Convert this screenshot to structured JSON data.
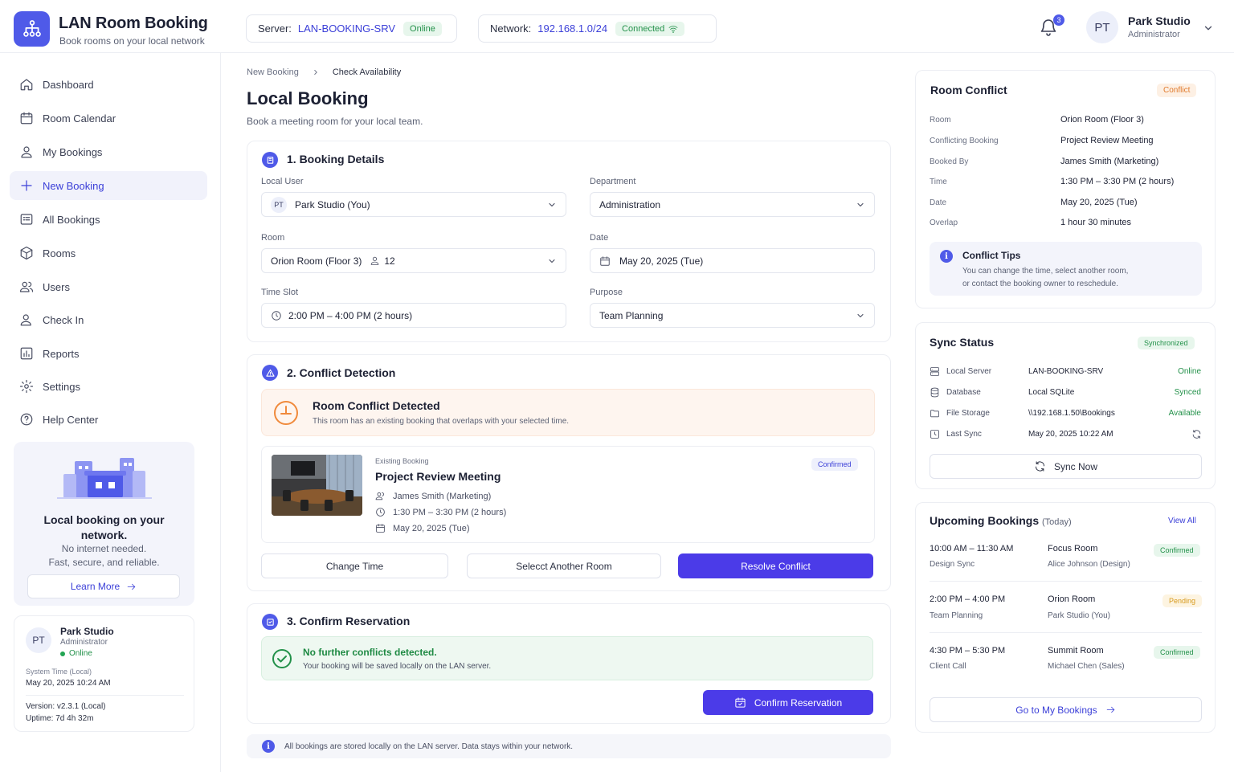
{
  "app": {
    "title": "LAN Room Booking",
    "subtitle": "Book rooms on your local network",
    "server_label": "Server:",
    "server_value": "LAN-BOOKING-SRV",
    "server_status": "Online",
    "network_label": "Network:",
    "network_value": "192.168.1.0/24",
    "network_status": "Connected",
    "notification_count": "3",
    "user_initials": "PT",
    "user_name": "Park Studio",
    "user_role": "Administrator"
  },
  "sidebar": {
    "items": [
      {
        "label": "Dashboard",
        "icon": "home-icon"
      },
      {
        "label": "Room Calendar",
        "icon": "calendar-icon"
      },
      {
        "label": "My Bookings",
        "icon": "user-icon"
      },
      {
        "label": "New Booking",
        "icon": "plus-icon",
        "active": true
      },
      {
        "label": "All Bookings",
        "icon": "list-icon"
      },
      {
        "label": "Rooms",
        "icon": "cube-icon"
      },
      {
        "label": "Users",
        "icon": "users-icon"
      },
      {
        "label": "Check In",
        "icon": "user-check-icon"
      },
      {
        "label": "Reports",
        "icon": "chart-icon"
      },
      {
        "label": "Settings",
        "icon": "gear-icon"
      },
      {
        "label": "Help Center",
        "icon": "help-icon"
      }
    ],
    "promo": {
      "title": "Local booking on your network.",
      "sub1": "No internet needed.",
      "sub2": "Fast, secure, and reliable.",
      "button": "Learn More"
    },
    "user_card": {
      "initials": "PT",
      "name": "Park Studio",
      "role": "Administrator",
      "status": "Online",
      "system_time_label": "System Time (Local)",
      "system_time": "May 20, 2025 10:24 AM",
      "version_label": "Version:",
      "version": "v2.3.1 (Local)",
      "uptime_label": "Uptime:",
      "uptime": "7d 4h 32m"
    }
  },
  "main": {
    "breadcrumb": [
      "New Booking",
      "Check Availability"
    ],
    "title": "Local Booking",
    "subtitle": "Book a meeting room for your local team.",
    "step1": {
      "title": "1. Booking Details",
      "local_user_label": "Local User",
      "local_user_initials": "PT",
      "local_user_value": "Park Studio (You)",
      "department_label": "Department",
      "department_value": "Administration",
      "room_label": "Room",
      "room_value": "Orion Room (Floor 3)",
      "room_capacity": "12",
      "date_label": "Date",
      "date_value": "May 20, 2025 (Tue)",
      "time_label": "Time Slot",
      "time_value": "2:00 PM – 4:00 PM (2 hours)",
      "purpose_label": "Purpose",
      "purpose_value": "Team Planning"
    },
    "step2": {
      "title": "2. Conflict Detection",
      "alert_title": "Room Conflict Detected",
      "alert_sub": "This room has an existing booking that overlaps with your selected time.",
      "existing_label": "Existing Booking",
      "existing_title": "Project Review Meeting",
      "existing_status": "Confirmed",
      "existing_owner": "James Smith (Marketing)",
      "existing_time": "1:30 PM – 3:30 PM (2 hours)",
      "existing_date": "May 20, 2025 (Tue)",
      "btn_change": "Change Time",
      "btn_select": "Selecct Another Room",
      "btn_resolve": "Resolve Conflict"
    },
    "step3": {
      "title": "3. Confirm Reservation",
      "ok_title": "No further conflicts detected.",
      "ok_sub": "Your booking will be saved locally on the LAN server.",
      "btn_confirm": "Confirm Reservation"
    },
    "footnote": "All bookings are stored locally on the LAN server. Data stays within your network."
  },
  "conflict_panel": {
    "title": "Room Conflict",
    "tag": "Conflict",
    "rows": [
      {
        "k": "Room",
        "v": "Orion Room (Floor 3)"
      },
      {
        "k": "Conflicting Booking",
        "v": "Project Review Meeting"
      },
      {
        "k": "Booked By",
        "v": "James Smith (Marketing)"
      },
      {
        "k": "Time",
        "v": "1:30 PM – 3:30 PM (2 hours)"
      },
      {
        "k": "Date",
        "v": "May 20, 2025 (Tue)"
      },
      {
        "k": "Overlap",
        "v": "1 hour 30 minutes"
      }
    ],
    "tips_title": "Conflict Tips",
    "tips_line1": "You can change the time, select another room,",
    "tips_line2": "or contact the booking owner to reschedule."
  },
  "sync_panel": {
    "title": "Sync Status",
    "tag": "Synchronized",
    "rows": [
      {
        "k": "Local Server",
        "v": "LAN-BOOKING-SRV",
        "s": "Online",
        "icon": "server-icon"
      },
      {
        "k": "Database",
        "v": "Local SQLite",
        "s": "Synced",
        "icon": "database-icon"
      },
      {
        "k": "File Storage",
        "v": "\\\\192.168.1.50\\Bookings",
        "s": "Available",
        "icon": "folder-icon"
      },
      {
        "k": "Last Sync",
        "v": "May 20, 2025 10:22 AM",
        "s": "",
        "icon": "clock-icon"
      }
    ],
    "button": "Sync Now"
  },
  "upcoming": {
    "title": "Upcoming Bookings",
    "title_suffix": "(Today)",
    "view_all": "View All",
    "items": [
      {
        "time": "10:00 AM – 11:30 AM",
        "desc": "Design Sync",
        "room": "Focus Room",
        "who": "Alice Johnson (Design)",
        "status": "Confirmed"
      },
      {
        "time": "2:00 PM – 4:00 PM",
        "desc": "Team Planning",
        "room": "Orion Room",
        "who": "Park Studio (You)",
        "status": "Pending"
      },
      {
        "time": "4:30 PM – 5:30 PM",
        "desc": "Client Call",
        "room": "Summit Room",
        "who": "Michael Chen (Sales)",
        "status": "Confirmed"
      }
    ],
    "button": "Go to My Bookings"
  },
  "colors": {
    "accent": "#4f5ae8",
    "primary_button": "#4b3be8",
    "success": "#23914a",
    "warning": "#f08a3c"
  }
}
